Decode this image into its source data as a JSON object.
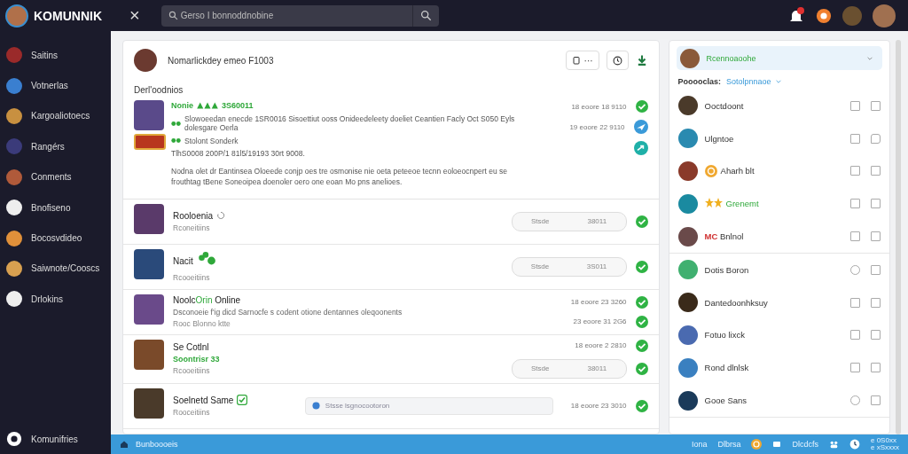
{
  "topbar": {
    "logo": "KOMUNNIK",
    "close": "×",
    "search": {
      "placeholder": "Gerso I bonnoddnobine"
    }
  },
  "sidebar": {
    "items": [
      {
        "label": "Saitins"
      },
      {
        "label": "Votnerlas"
      },
      {
        "label": "Kargoaliotoecs"
      },
      {
        "label": "Rangérs"
      },
      {
        "label": "Conments"
      },
      {
        "label": "Bnofiseno"
      },
      {
        "label": "Bocosvdideo"
      },
      {
        "label": "Saiwnote/Cooscs"
      },
      {
        "label": "Drlokins"
      }
    ],
    "footer": {
      "label": "Komunifries"
    }
  },
  "feed": {
    "header": {
      "title": "Nomarlickdey emeo F1003",
      "more": "···"
    },
    "section_title": "Derl'oodnios",
    "featured": {
      "title": "Nonie",
      "code": "3S60011",
      "lines": [
        "Slowoeedan enecde 1SR0016 Sisoettiut ooss Onideedeleety doeliet Ceantien Facly Oct S050 Eyls dolesgare Oerla",
        "Stolont Sonderk"
      ],
      "meta": "TlhS0008 200P/1 81l5/19193 30rt 9008.",
      "paragraph": "Nodna olet dr Eantinsea Oloeede conjp oes tre osmonise nie oeta peteeoe tecnn eoloeocnpert eu se frouthtag tBene Soneoipea doenoler oero one eoan Mo pns anelioes.",
      "times": [
        "18 eoore 18 9110",
        "19 eoore 22 9110"
      ],
      "status": [
        {
          "kind": "done"
        },
        {
          "kind": "sent"
        },
        {
          "kind": "shared"
        }
      ]
    },
    "rows": [
      {
        "name": [
          {
            "text": "Rooloenia",
            "accent": false
          }
        ],
        "mark": {
          "kind": "loading"
        },
        "subtitle": "Rconeitiins",
        "pill": {
          "label": "Stsde",
          "value": "38011"
        },
        "times": [],
        "status": [
          {
            "kind": "done"
          }
        ]
      },
      {
        "name": [
          {
            "text": "Nacit",
            "accent": false
          }
        ],
        "mark": {
          "kind": "clover"
        },
        "subtitle": "Rcooeitiins",
        "pill": {
          "label": "Stsde",
          "value": "3S011"
        },
        "times": [],
        "status": [
          {
            "kind": "done"
          }
        ]
      },
      {
        "name": [
          {
            "text": "Noolc",
            "accent": false
          },
          {
            "text": "Orin",
            "accent": true
          },
          {
            "text": " Online",
            "accent": false
          }
        ],
        "body": "Dsconoeie f'ig dicd Sarnocfe s codent otione dentannes oleqoonents",
        "subtitle": "Rooc Blonno ktte",
        "times": [
          "18 eoore 23 3260",
          "23 eoore 31 2G6"
        ],
        "status": [
          {
            "kind": "done"
          },
          {
            "kind": "done"
          }
        ]
      },
      {
        "name": [
          {
            "text": "Se Cotlnl",
            "accent": false
          }
        ],
        "tag": "Soontrisr 33",
        "subtitle": "Rcooeitiins",
        "pill": {
          "label": "Stsde",
          "value": "38011"
        },
        "times": [
          "18 eoore 2 2810"
        ],
        "status": [
          {
            "kind": "done"
          },
          {
            "kind": "done"
          }
        ]
      },
      {
        "name": [
          {
            "text": "Soelnetd Same",
            "accent": false
          }
        ],
        "mark": {
          "kind": "check"
        },
        "subtitle": "Rooceitiins",
        "field": {
          "placeholder": "Stsse lsgnocootoron"
        },
        "times": [
          "18 eoore 23 3010"
        ],
        "status": [
          {
            "kind": "done"
          }
        ]
      }
    ]
  },
  "panel": {
    "selected": {
      "name": "Rcennoaoohe"
    },
    "filter": {
      "label": "Pooooclas:",
      "value": "Sotolpnnaoe"
    },
    "groups": [
      [
        {
          "name": "Ooctdoont",
          "accent": false,
          "boxes": [
            {
              "kind": "square",
              "checked": false
            },
            {
              "kind": "square",
              "checked": false
            }
          ]
        },
        {
          "name": "Ulgntoe",
          "accent": false,
          "boxes": [
            {
              "kind": "square",
              "checked": false
            },
            {
              "kind": "bubble",
              "checked": false
            }
          ]
        },
        {
          "name": "Aharh blt",
          "accent": false,
          "badge": {
            "kind": "coin"
          },
          "boxes": [
            {
              "kind": "square",
              "checked": false
            },
            {
              "kind": "square",
              "checked": false
            }
          ]
        },
        {
          "name": "Grenemt",
          "accent": true,
          "badge": {
            "kind": "stars"
          },
          "boxes": [
            {
              "kind": "square",
              "checked": false
            },
            {
              "kind": "square",
              "checked": false
            }
          ]
        },
        {
          "name": "Bnlnol",
          "accent": false,
          "prefix": "MC",
          "boxes": [
            {
              "kind": "square",
              "checked": false
            },
            {
              "kind": "square",
              "checked": false
            }
          ]
        }
      ],
      [
        {
          "name": "Dotis Boron",
          "accent": false,
          "boxes": [
            {
              "kind": "circle",
              "checked": false
            },
            {
              "kind": "square",
              "checked": false
            }
          ]
        },
        {
          "name": "Dantedoonhksuy",
          "accent": false,
          "boxes": [
            {
              "kind": "square",
              "checked": false
            },
            {
              "kind": "square",
              "checked": false
            }
          ]
        },
        {
          "name": "Fotuo lixck",
          "accent": false,
          "boxes": [
            {
              "kind": "square",
              "checked": false
            },
            {
              "kind": "square",
              "checked": false
            }
          ]
        },
        {
          "name": "Rond dlnlsk",
          "accent": false,
          "boxes": [
            {
              "kind": "square",
              "checked": false
            },
            {
              "kind": "square",
              "checked": false
            }
          ]
        },
        {
          "name": "Gooe Sans",
          "accent": false,
          "boxes": [
            {
              "kind": "circle",
              "checked": false
            },
            {
              "kind": "square",
              "checked": false
            }
          ]
        }
      ]
    ]
  },
  "bottombar": {
    "label": "Bunboooeis",
    "links": [
      "Iona",
      "Dlbrsa"
    ],
    "counter": "Dlcdcfs",
    "notes": [
      "e 0S0xx",
      "e xSxxxx"
    ]
  }
}
